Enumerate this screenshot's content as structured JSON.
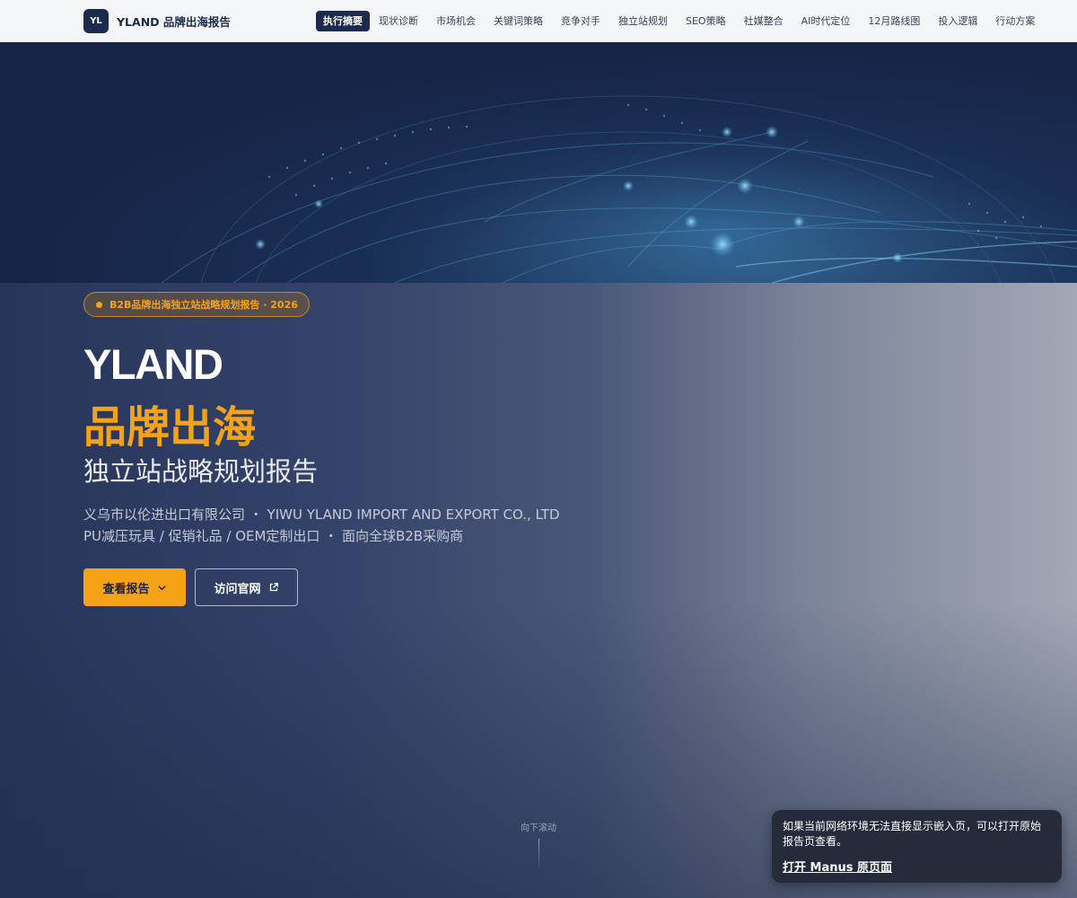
{
  "header": {
    "logo_text": "YL",
    "brand": "YLAND 品牌出海报告",
    "nav": [
      {
        "label": "执行摘要",
        "active": true
      },
      {
        "label": "现状诊断",
        "active": false
      },
      {
        "label": "市场机会",
        "active": false
      },
      {
        "label": "关键词策略",
        "active": false
      },
      {
        "label": "竞争对手",
        "active": false
      },
      {
        "label": "独立站规划",
        "active": false
      },
      {
        "label": "SEO策略",
        "active": false
      },
      {
        "label": "社媒整合",
        "active": false
      },
      {
        "label": "AI时代定位",
        "active": false
      },
      {
        "label": "12月路线图",
        "active": false
      },
      {
        "label": "投入逻辑",
        "active": false
      },
      {
        "label": "行动方案",
        "active": false
      }
    ]
  },
  "hero": {
    "badge": "B2B品牌出海独立站战略规划报告 · 2026",
    "title_en": "YLAND",
    "title_cn": "品牌出海",
    "subtitle": "独立站战略规划报告",
    "desc_line1": "义乌市以伦进出口有限公司 ・ YIWU YLAND IMPORT AND EXPORT CO., LTD",
    "desc_line2": "PU减压玩具 / 促销礼品 / OEM定制出口 ・ 面向全球B2B采购商",
    "primary_button": "查看报告",
    "secondary_button": "访问官网",
    "scroll_hint": "向下滚动"
  },
  "toast": {
    "message": "如果当前网络环境无法直接显示嵌入页，可以打开原始报告页查看。",
    "link": "打开 Manus 原页面"
  },
  "colors": {
    "navy": "#1c2a4d",
    "accent": "#f5a316",
    "toast_bg": "#252b3a"
  },
  "icons": [
    "chevron-down-icon",
    "external-link-icon",
    "globe-network-illustration"
  ]
}
